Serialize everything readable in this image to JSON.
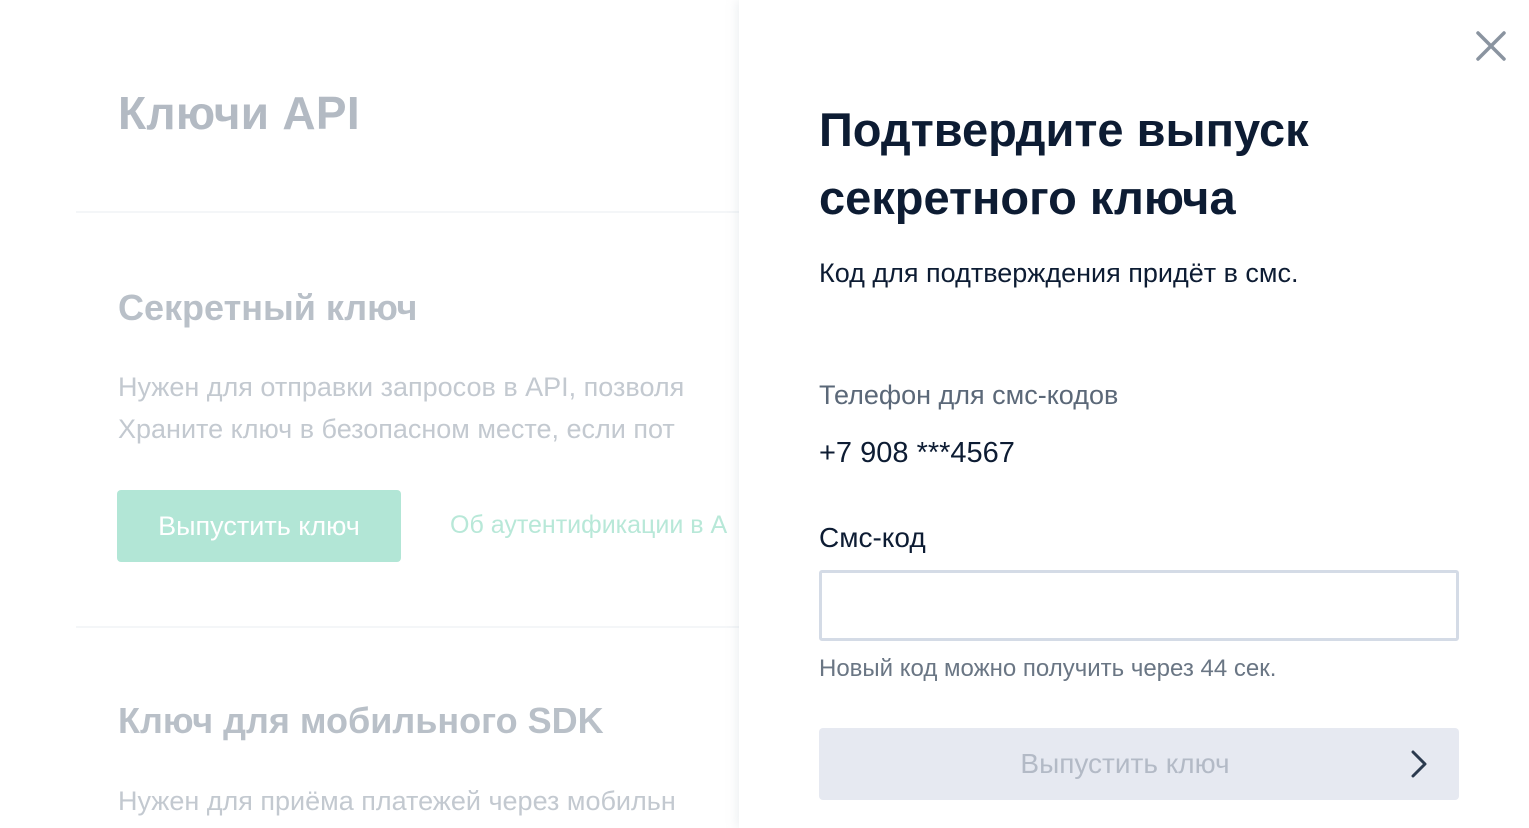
{
  "background": {
    "page_title": "Ключи API",
    "secret_key": {
      "title": "Секретный ключ",
      "description_line1": "Нужен для отправки запросов в API, позволя",
      "description_line2": "Храните ключ в безопасном месте, если пот",
      "issue_button": "Выпустить ключ",
      "auth_link": "Об аутентификации в А"
    },
    "mobile_sdk_key": {
      "title": "Ключ для мобильного SDK",
      "description_line1": "Нужен для приёма платежей через мобильн"
    }
  },
  "panel": {
    "title": "Подтвердите выпуск секретного ключа",
    "subtitle": "Код для подтверждения придёт в смс.",
    "phone_label": "Телефон для смс-кодов",
    "phone_value": "+7 908 ***4567",
    "sms_label": "Смс-код",
    "sms_value": "",
    "resend_hint": "Новый код можно получить через 44 сек.",
    "submit_button": "Выпустить ключ",
    "submit_disabled": true
  },
  "colors": {
    "accent_disabled": "#b2e6d6",
    "title_text": "#0d1c33",
    "muted_text": "#6a7684",
    "input_border": "#d4dbe6",
    "disabled_button_bg": "#e6e9f1"
  },
  "icons": {
    "close": "close-icon",
    "submit": "chevron-right-icon"
  }
}
